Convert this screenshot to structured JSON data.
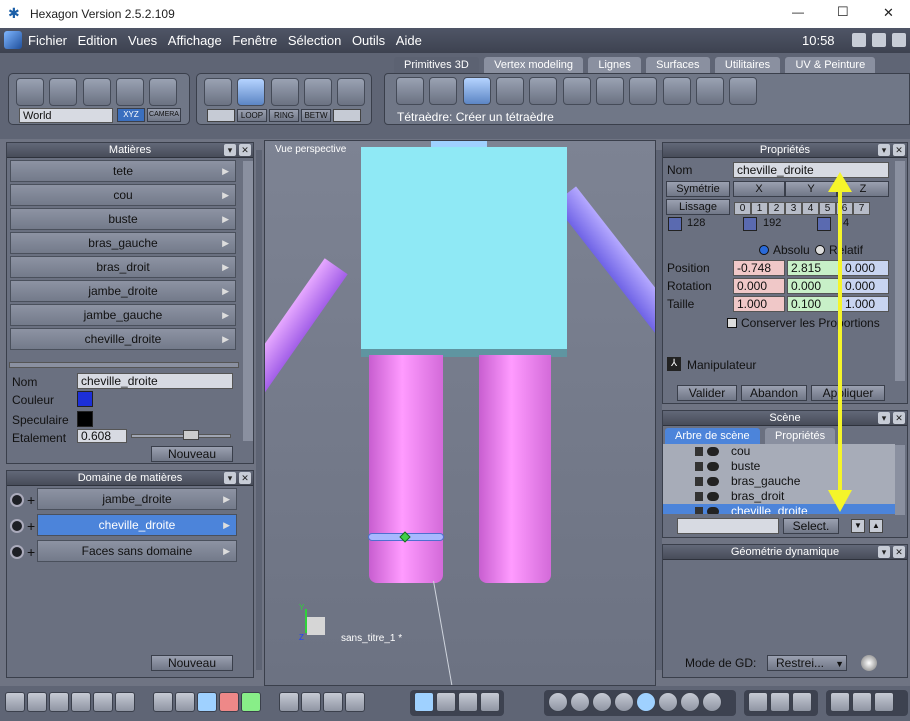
{
  "app": {
    "title": "Hexagon Version 2.5.2.109",
    "window_min": "—",
    "window_max": "☐",
    "window_close": "✕"
  },
  "menu": {
    "items": [
      "Fichier",
      "Edition",
      "Vues",
      "Affichage",
      "Fenêtre",
      "Sélection",
      "Outils",
      "Aide"
    ],
    "clock": "10:58"
  },
  "toolbar": {
    "world": "World",
    "xyz": "XYZ",
    "camera": "CAMERA",
    "loop": "LOOP",
    "ring": "RING",
    "betw": "BETW",
    "tabs": [
      "Primitives 3D",
      "Vertex modeling",
      "Lignes",
      "Surfaces",
      "Utilitaires",
      "UV & Peinture"
    ],
    "status": "Tétraèdre: Créer un tétraèdre"
  },
  "matieres": {
    "title": "Matières",
    "items": [
      "tete",
      "cou",
      "buste",
      "bras_gauche",
      "bras_droit",
      "jambe_droite",
      "jambe_gauche",
      "cheville_droite"
    ],
    "nom_label": "Nom",
    "nom_value": "cheville_droite",
    "couleur_label": "Couleur",
    "speculaire_label": "Speculaire",
    "etalement_label": "Etalement",
    "etalement_value": "0.608",
    "nouveau": "Nouveau",
    "colors": {
      "couleur": "#1c2fd8",
      "speculaire": "#000000"
    }
  },
  "domaine": {
    "title": "Domaine de matières",
    "items": [
      "jambe_droite",
      "cheville_droite",
      "Faces sans domaine"
    ],
    "nouveau": "Nouveau"
  },
  "viewport": {
    "label": "Vue perspective",
    "scene_name": "sans_titre_1 *",
    "axis_y": "Y",
    "axis_z": "Z"
  },
  "props": {
    "title": "Propriétés",
    "nom_label": "Nom",
    "nom_value": "cheville_droite",
    "symetrie": "Symétrie",
    "x": "X",
    "y": "Y",
    "z": "Z",
    "lissage": "Lissage",
    "lissage_levels": [
      "0",
      "1",
      "2",
      "3",
      "4",
      "5",
      "6",
      "7"
    ],
    "c1": "128",
    "c2": "192",
    "c3": "4",
    "absolu": "Absolu",
    "relatif": "Relatif",
    "position_label": "Position",
    "position": [
      "-0.748",
      "2.815",
      "0.000"
    ],
    "rotation_label": "Rotation",
    "rotation": [
      "0.000",
      "0.000",
      "0.000"
    ],
    "taille_label": "Taille",
    "taille": [
      "1.000",
      "0.100",
      "1.000"
    ],
    "conserver": "Conserver les Proportions",
    "manipulateur": "Manipulateur",
    "valider": "Valider",
    "abandon": "Abandon",
    "appliquer": "Appliquer"
  },
  "scene": {
    "title": "Scène",
    "tab1": "Arbre de scène",
    "tab2": "Propriétés",
    "items": [
      "cou",
      "buste",
      "bras_gauche",
      "bras_droit",
      "cheville_droite"
    ],
    "select": "Select."
  },
  "geo": {
    "title": "Géométrie dynamique",
    "mode_label": "Mode de GD:",
    "mode_value": "Restrei..."
  }
}
